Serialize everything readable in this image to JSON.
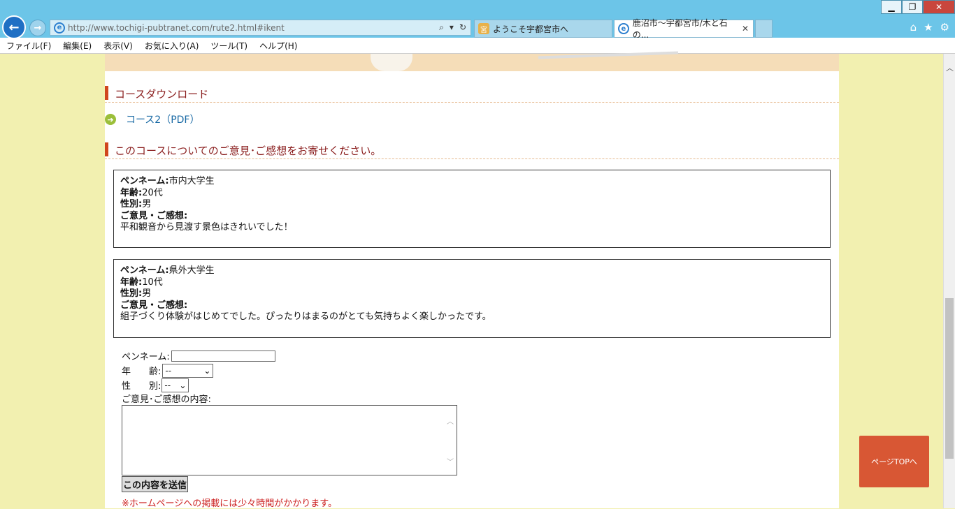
{
  "browser": {
    "address_url": "http://www.tochigi-pubtranet.com/rute2.html#ikent",
    "tabs": [
      {
        "label": "ようこそ宇都宮市へ",
        "active": false
      },
      {
        "label": "鹿沼市～宇都宮市/木と石の...",
        "active": true
      }
    ],
    "menu": [
      "ファイル(F)",
      "編集(E)",
      "表示(V)",
      "お気に入り(A)",
      "ツール(T)",
      "ヘルプ(H)"
    ]
  },
  "page": {
    "download_heading": "コースダウンロード",
    "pdf_link": "コース2（PDF）",
    "feedback_heading": "このコースについてのご意見･ご感想をお寄せください。",
    "comments": [
      {
        "penname_label": "ペンネーム:",
        "penname": "市内大学生",
        "age_label": "年齢:",
        "age": "20代",
        "gender_label": "性別:",
        "gender": "男",
        "opinion_label": "ご意見・ご感想:",
        "opinion": "平和観音から見渡す景色はきれいでした！"
      },
      {
        "penname_label": "ペンネーム:",
        "penname": "県外大学生",
        "age_label": "年齢:",
        "age": "10代",
        "gender_label": "性別:",
        "gender": "男",
        "opinion_label": "ご意見・ご感想:",
        "opinion": "組子づくり体験がはじめてでした。ぴったりはまるのがとても気持ちよく楽しかったです。"
      }
    ],
    "form": {
      "penname_label": "ペンネーム:",
      "penname_value": "",
      "age_label": "年　　齢:",
      "age_selected": "--",
      "gender_label": "性　　別:",
      "gender_selected": "--",
      "content_label": "ご意見･ご感想の内容:",
      "content_value": "",
      "submit_label": "この内容を送信"
    },
    "note": "※ホームページへの掲載には少々時間がかかります。",
    "pagetop_label": "ページTOPへ"
  },
  "colors": {
    "accent_bar": "#d0461e",
    "heading_text": "#8a1d1d",
    "link": "#1a6aa5",
    "pagetop_bg": "#d85734",
    "note_text": "#cc1f1f"
  }
}
